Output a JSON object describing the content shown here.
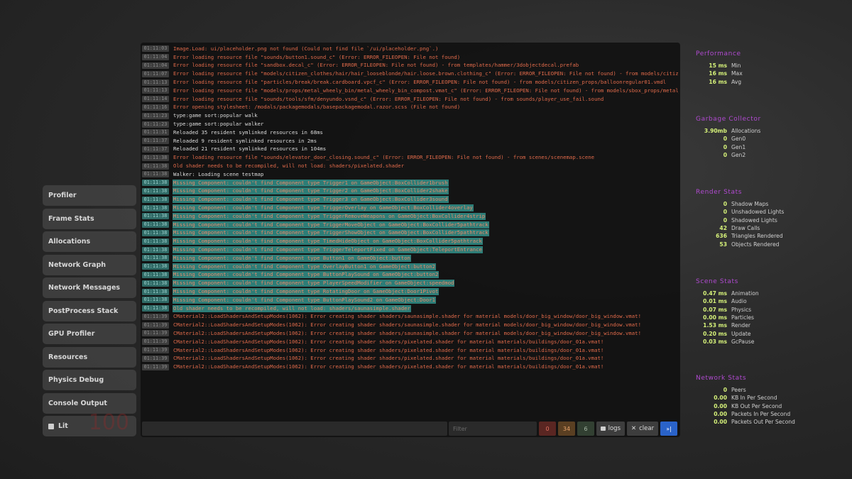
{
  "menu": {
    "items": [
      {
        "label": "Profiler"
      },
      {
        "label": "Frame Stats"
      },
      {
        "label": "Allocations"
      },
      {
        "label": "Network Graph"
      },
      {
        "label": "Network Messages"
      },
      {
        "label": "PostProcess Stack"
      },
      {
        "label": "GPU Profiler"
      },
      {
        "label": "Resources"
      },
      {
        "label": "Physics Debug"
      },
      {
        "label": "Console Output"
      },
      {
        "label": "Lit",
        "icon": "square-icon"
      }
    ],
    "fps_overlay": "100"
  },
  "console": {
    "lines": [
      {
        "time": "01:11:03",
        "type": "error",
        "text": "Image.Load: ui/placeholder.png not found (Could not find file `/ui/placeholder.png`.)"
      },
      {
        "time": "01:11:04",
        "type": "error",
        "text": "Error loading resource file \"sounds/button1.sound_c\" (Error: ERROR_FILEOPEN: File not found)"
      },
      {
        "time": "01:11:04",
        "type": "error",
        "text": "Error loading resource file \"sandbox.decal_c\" (Error: ERROR_FILEOPEN: File not found) - from templates/hammer/3dobjectdecal.prefab"
      },
      {
        "time": "01:11:07",
        "type": "error",
        "text": "Error loading resource file \"models/citizen_clothes/hair/hair_looseblonde/hair.loose.brown.clothing_c\" (Error: ERROR_FILEOPEN: File not found) - from models/citizen_clothes/"
      },
      {
        "time": "01:11:13",
        "type": "error",
        "text": "Error loading resource file \"particles/break/break.cardboard.vpcf_c\" (Error: ERROR_FILEOPEN: File not found) - from models/citizen_props/balloonregular01.vmdl"
      },
      {
        "time": "01:11:13",
        "type": "error",
        "text": "Error loading resource file \"models/props/metal_wheely_bin/metal_wheely_bin_compost.vmat_c\" (Error: ERROR_FILEOPEN: File not found) - from models/sbox_props/metal_wheely_bin"
      },
      {
        "time": "01:11:14",
        "type": "error",
        "text": "Error loading resource file \"sounds/tools/sfm/denyundo.vsnd_c\" (Error: ERROR_FILEOPEN: File not found) - from sounds/player_use_fail.sound"
      },
      {
        "time": "01:11:16",
        "type": "error",
        "text": "Error opening stylesheet: /modals/packagemodals/basepackagemodal.razor.scss (File not found)"
      },
      {
        "time": "01:11:23",
        "type": "info",
        "text": "type:game sort:popular walk"
      },
      {
        "time": "01:11:23",
        "type": "info",
        "text": "type:game sort:popular walker"
      },
      {
        "time": "01:11:31",
        "type": "info",
        "text": "Reloaded 35 resident symlinked resources in 68ms"
      },
      {
        "time": "01:11:37",
        "type": "info",
        "text": "Reloaded 9 resident symlinked resources in 2ms"
      },
      {
        "time": "01:11:37",
        "type": "info",
        "text": "Reloaded 21 resident symlinked resources in 104ms"
      },
      {
        "time": "01:11:38",
        "type": "error",
        "text": "Error loading resource file \"sounds/elevator_door_closing.sound_c\" (Error: ERROR_FILEOPEN: File not found) - from scenes/scenemap.scene"
      },
      {
        "time": "01:11:38",
        "type": "error",
        "text": "Old shader needs to be recompiled, will not load: shaders/pixelated.shader"
      },
      {
        "time": "01:11:38",
        "type": "info",
        "text": "Walker: Loading scene testmap"
      },
      {
        "time": "01:11:38",
        "type": "warn",
        "text": "Missing Component: couldn't find Component type Trigger1 on GameObject:BoxCollider1brush"
      },
      {
        "time": "01:11:38",
        "type": "warn",
        "text": "Missing Component: couldn't find Component type Trigger2 on GameObject:BoxCollider2shake"
      },
      {
        "time": "01:11:38",
        "type": "warn",
        "text": "Missing Component: couldn't find Component type Trigger3 on GameObject:BoxCollider3sound"
      },
      {
        "time": "01:11:38",
        "type": "warn",
        "text": "Missing Component: couldn't find Component type TriggerOverlay on GameObject:BoxCollider4overlay"
      },
      {
        "time": "01:11:38",
        "type": "warn",
        "text": "Missing Component: couldn't find Component type TriggerRemoveWeapons on GameObject:BoxCollider4strip"
      },
      {
        "time": "01:11:38",
        "type": "warn",
        "text": "Missing Component: couldn't find Component type TriggerMoveObject on GameObject:BoxCollider5pathtrack"
      },
      {
        "time": "01:11:38",
        "type": "warn",
        "text": "Missing Component: couldn't find Component type TriggerShowObject on GameObject:BoxCollider5pathtrack"
      },
      {
        "time": "01:11:38",
        "type": "warn",
        "text": "Missing Component: couldn't find Component type TimedHideObject on GameObject:BoxCollider5pathtrack"
      },
      {
        "time": "01:11:38",
        "type": "warn",
        "text": "Missing Component: couldn't find Component type TriggerTeleportFixed on GameObject:TeleportEntrance"
      },
      {
        "time": "01:11:38",
        "type": "warn",
        "text": "Missing Component: couldn't find Component type Button1 on GameObject:button"
      },
      {
        "time": "01:11:38",
        "type": "warn",
        "text": "Missing Component: couldn't find Component type OverlayButton1 on GameObject:button2"
      },
      {
        "time": "01:11:38",
        "type": "warn",
        "text": "Missing Component: couldn't find Component type ButtonPlaySound on GameObject:button2"
      },
      {
        "time": "01:11:38",
        "type": "warn",
        "text": "Missing Component: couldn't find Component type PlayerSpeedModifier on GameObject:speedmod"
      },
      {
        "time": "01:11:38",
        "type": "warn",
        "text": "Missing Component: couldn't find Component type RotatingDoor on GameObject:Door1Pivot"
      },
      {
        "time": "01:11:38",
        "type": "warn",
        "text": "Missing Component: couldn't find Component type ButtonPlaySound2 on GameObject:Door1"
      },
      {
        "time": "01:11:38",
        "type": "warn",
        "text": "Old shader needs to be recompiled, will not load: shaders/saunasimple.shader"
      },
      {
        "time": "01:11:39",
        "type": "error",
        "text": "CMaterial2::LoadShadersAndSetupModes(1062): Error creating shader shaders/saunasimple.shader for material models/door_big_window/door_big_window.vmat!"
      },
      {
        "time": "01:11:39",
        "type": "error",
        "text": "CMaterial2::LoadShadersAndSetupModes(1062): Error creating shader shaders/saunasimple.shader for material models/door_big_window/door_big_window.vmat!"
      },
      {
        "time": "01:11:39",
        "type": "error",
        "text": "CMaterial2::LoadShadersAndSetupModes(1062): Error creating shader shaders/saunasimple.shader for material models/door_big_window/door_big_window.vmat!"
      },
      {
        "time": "01:11:39",
        "type": "error",
        "text": "CMaterial2::LoadShadersAndSetupModes(1062): Error creating shader shaders/pixelated.shader for material materials/buildings/door_01a.vmat!"
      },
      {
        "time": "01:11:39",
        "type": "error",
        "text": "CMaterial2::LoadShadersAndSetupModes(1062): Error creating shader shaders/pixelated.shader for material materials/buildings/door_01a.vmat!"
      },
      {
        "time": "01:11:39",
        "type": "error",
        "text": "CMaterial2::LoadShadersAndSetupModes(1062): Error creating shader shaders/pixelated.shader for material materials/buildings/door_01a.vmat!"
      },
      {
        "time": "01:11:39",
        "type": "error",
        "text": "CMaterial2::LoadShadersAndSetupModes(1062): Error creating shader shaders/pixelated.shader for material materials/buildings/door_01a.vmat!"
      }
    ],
    "input_value": "",
    "filter_placeholder": "Filter",
    "counts": {
      "errors": "0",
      "warnings": "34",
      "info": "6"
    },
    "logs_label": "logs",
    "clear_label": "clear",
    "run_label": "»|"
  },
  "stats": {
    "performance": {
      "title": "Performance",
      "rows": [
        {
          "value": "15",
          "unit": "ms",
          "label": "Min"
        },
        {
          "value": "16",
          "unit": "ms",
          "label": "Max"
        },
        {
          "value": "16",
          "unit": "ms",
          "label": "Avg"
        }
      ]
    },
    "gc": {
      "title": "Garbage Collector",
      "rows": [
        {
          "value": "3.90mb",
          "unit": "",
          "label": "Allocations"
        },
        {
          "value": "0",
          "unit": "",
          "label": "Gen0"
        },
        {
          "value": "0",
          "unit": "",
          "label": "Gen1"
        },
        {
          "value": "0",
          "unit": "",
          "label": "Gen2"
        }
      ]
    },
    "render": {
      "title": "Render Stats",
      "rows": [
        {
          "value": "0",
          "unit": "",
          "label": "Shadow Maps"
        },
        {
          "value": "0",
          "unit": "",
          "label": "Unshadowed Lights"
        },
        {
          "value": "0",
          "unit": "",
          "label": "Shadowed Lights"
        },
        {
          "value": "42",
          "unit": "",
          "label": "Draw Calls"
        },
        {
          "value": "636",
          "unit": "",
          "label": "Triangles Rendered"
        },
        {
          "value": "53",
          "unit": "",
          "label": "Objects Rendered"
        }
      ]
    },
    "scene": {
      "title": "Scene Stats",
      "rows": [
        {
          "value": "0.47",
          "unit": "ms",
          "label": "Animation"
        },
        {
          "value": "0.01",
          "unit": "ms",
          "label": "Audio"
        },
        {
          "value": "0.07",
          "unit": "ms",
          "label": "Physics"
        },
        {
          "value": "0.00",
          "unit": "ms",
          "label": "Particles"
        },
        {
          "value": "1.53",
          "unit": "ms",
          "label": "Render"
        },
        {
          "value": "0.20",
          "unit": "ms",
          "label": "Update"
        },
        {
          "value": "0.03",
          "unit": "ms",
          "label": "GcPause"
        }
      ]
    },
    "network": {
      "title": "Network Stats",
      "rows": [
        {
          "value": "0",
          "unit": "",
          "label": "Peers"
        },
        {
          "value": "0.00",
          "unit": "",
          "label": "KB In Per Second"
        },
        {
          "value": "0.00",
          "unit": "",
          "label": "KB Out Per Second"
        },
        {
          "value": "0.00",
          "unit": "",
          "label": "Packets In Per Second"
        },
        {
          "value": "0.00",
          "unit": "",
          "label": "Packets Out Per Second"
        }
      ]
    }
  },
  "colors": {
    "stat_title": "#b04ad0",
    "stat_value": "#d6f27a",
    "error_text": "#e06a4a",
    "warn_highlight": "#2d7d77",
    "run_button": "#2a63c9"
  }
}
